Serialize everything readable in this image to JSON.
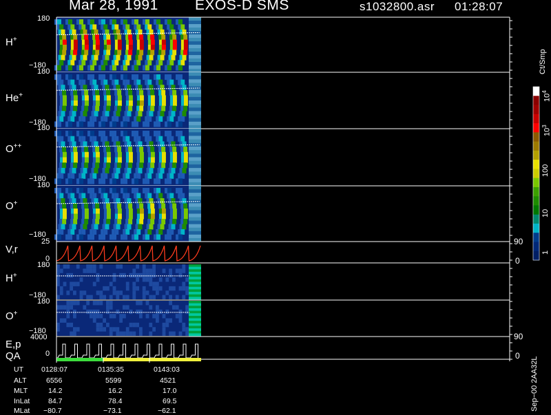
{
  "header": {
    "date": "Mar 28, 1991",
    "mission": "EXOS-D SMS",
    "file": "s1032800.asr",
    "time": "01:28:07"
  },
  "panels": [
    {
      "species_base": "H",
      "species_sup": "+",
      "y_top": "180",
      "y_bottom": "−180"
    },
    {
      "species_base": "He",
      "species_sup": "+",
      "y_top": "180",
      "y_bottom": "−180"
    },
    {
      "species_base": "O",
      "species_sup": "++",
      "y_top": "180",
      "y_bottom": "−180"
    },
    {
      "species_base": "O",
      "species_sup": "+",
      "y_top": "180",
      "y_bottom": "−180"
    }
  ],
  "vr_panel": {
    "label": "V,r",
    "y_top": "25",
    "y_bottom": "0",
    "right_top": "90",
    "right_bottom": "0"
  },
  "lower_panels": [
    {
      "species_base": "H",
      "species_sup": "+",
      "y_top": "180",
      "y_bottom": "−180"
    },
    {
      "species_base": "O",
      "species_sup": "+",
      "y_top": "180",
      "y_bottom": "−180"
    }
  ],
  "ep_panel": {
    "label": "E,p",
    "label2": "QA",
    "y_top": "4000",
    "y_bottom": "0",
    "right_top": "90",
    "right_bottom": "0"
  },
  "colorbar": {
    "unit": "Ct/Smp",
    "ticks": [
      {
        "base": "10",
        "sup": "4"
      },
      {
        "base": "10",
        "sup": "3"
      },
      {
        "base": "100",
        "sup": ""
      },
      {
        "base": "10",
        "sup": ""
      },
      {
        "base": "1",
        "sup": ""
      }
    ],
    "colors": [
      "#ffffff",
      "#8b0000",
      "#a00000",
      "#c80000",
      "#ff0000",
      "#8b5a00",
      "#9c7a00",
      "#b4a000",
      "#e8e000",
      "#cccc00",
      "#7ac800",
      "#3ca000",
      "#1e8c00",
      "#007800",
      "#008a6e",
      "#00b4c8",
      "#003c8c",
      "#002878",
      "#001e64"
    ]
  },
  "side_text": "Sep−00 2AA32L",
  "ephemeris": {
    "labels": [
      "UT",
      "ALT",
      "MLT",
      "InLat",
      "MLat"
    ],
    "columns": [
      [
        "0128:07",
        "6556",
        "14.2",
        "84.7",
        "−80.7"
      ],
      [
        "0135:35",
        "5599",
        "16.2",
        "78.4",
        "−73.1"
      ],
      [
        "0143:03",
        "4521",
        "17.0",
        "69.5",
        "−62.1"
      ]
    ]
  },
  "chart_data": {
    "type": "heatmap",
    "title": "Mar 28, 1991   EXOS-D SMS",
    "x_ticks_ut": [
      "0128:07",
      "0135:35",
      "0143:03"
    ],
    "panels": [
      "H+",
      "He+",
      "O++",
      "O+",
      "V,r",
      "H+",
      "O+",
      "E,p"
    ],
    "spin_sweeps": 12,
    "data_fraction_of_axis": 0.28
  }
}
